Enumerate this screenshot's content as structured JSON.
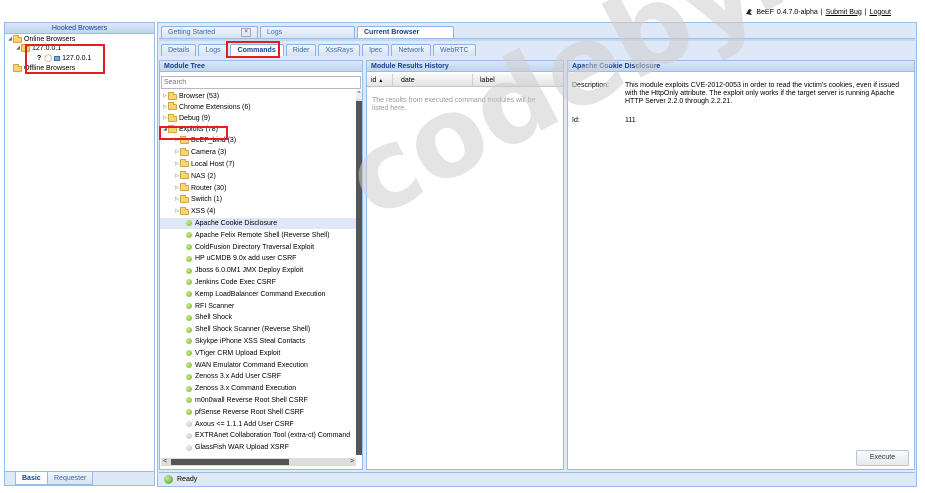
{
  "topbar": {
    "brand": "BeEF",
    "version": "0.4.7.0-alpha",
    "sep1": "|",
    "submit_bug": "Submit Bug",
    "sep2": "|",
    "logout": "Logout"
  },
  "hooked": {
    "title": "Hooked Browsers",
    "online_label": "Online Browsers",
    "host_folder": "127.0.0.1",
    "host_entry": "127.0.0.1",
    "offline_label": "Offline Browsers",
    "bottom_tabs": [
      "Basic",
      "Requester"
    ]
  },
  "main_tabs": {
    "getting_started": "Getting Started",
    "logs": "Logs",
    "current_browser": "Current Browser"
  },
  "sub_tabs": [
    "Details",
    "Logs",
    "Commands",
    "Rider",
    "XssRays",
    "Ipec",
    "Network",
    "WebRTC"
  ],
  "module_tree": {
    "title": "Module Tree",
    "search_placeholder": "Search",
    "folders": [
      {
        "label": "Browser (53)"
      },
      {
        "label": "Chrome Extensions (6)"
      },
      {
        "label": "Debug (9)"
      },
      {
        "label": "Exploits (78)"
      }
    ],
    "exploit_folders": [
      {
        "label": "BeEF_bind (3)"
      },
      {
        "label": "Camera (3)"
      },
      {
        "label": "Local Host (7)"
      },
      {
        "label": "NAS (2)"
      },
      {
        "label": "Router (30)"
      },
      {
        "label": "Switch (1)"
      },
      {
        "label": "XSS (4)"
      }
    ],
    "modules": [
      {
        "label": "Apache Cookie Disclosure",
        "status": "green"
      },
      {
        "label": "Apache Felix Remote Shell (Reverse Shell)",
        "status": "green"
      },
      {
        "label": "ColdFusion Directory Traversal Exploit",
        "status": "green"
      },
      {
        "label": "HP uCMDB 9.0x add user CSRF",
        "status": "green"
      },
      {
        "label": "Jboss 6.0.0M1 JMX Deploy Exploit",
        "status": "green"
      },
      {
        "label": "Jenkins Code Exec CSRF",
        "status": "green"
      },
      {
        "label": "Kemp LoadBalancer Command Execution",
        "status": "green"
      },
      {
        "label": "RFI Scanner",
        "status": "green"
      },
      {
        "label": "Shell Shock",
        "status": "green"
      },
      {
        "label": "Shell Shock Scanner (Reverse Shell)",
        "status": "green"
      },
      {
        "label": "Skykpe iPhone XSS Steal Contacts",
        "status": "green"
      },
      {
        "label": "VTiger CRM Upload Exploit",
        "status": "green"
      },
      {
        "label": "WAN Emulator Command Execution",
        "status": "green"
      },
      {
        "label": "Zenoss 3.x Add User CSRF",
        "status": "green"
      },
      {
        "label": "Zenoss 3.x Command Execution",
        "status": "green"
      },
      {
        "label": "m0n0wall Reverse Root Shell CSRF",
        "status": "green"
      },
      {
        "label": "pfSense Reverse Root Shell CSRF",
        "status": "green"
      },
      {
        "label": "Axous <= 1.1.1 Add User CSRF",
        "status": "grey"
      },
      {
        "label": "EXTRAnet Collaboration Tool (extra-ct) Command",
        "status": "grey"
      },
      {
        "label": "GlassFish WAR Upload XSRF",
        "status": "grey"
      }
    ]
  },
  "results": {
    "title": "Module Results History",
    "col_id": "id",
    "col_date": "date",
    "col_label": "label",
    "empty_text": "The results from executed command modules will be listed here."
  },
  "detail": {
    "title": "Apache Cookie Disclosure",
    "desc_label": "Description:",
    "description": "This module exploits CVE-2012-0053 in order to read the victim's cookies, even if issued with the HttpOnly attribute. The exploit only works if the target server is running Apache HTTP Server 2.2.0 through 2.2.21.",
    "id_label": "Id:",
    "id_value": "111",
    "execute_label": "Execute"
  },
  "status": {
    "text": "Ready"
  },
  "watermark": "codeby.net"
}
